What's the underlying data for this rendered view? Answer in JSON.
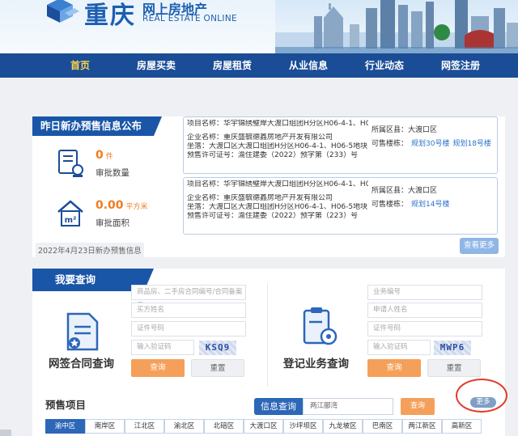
{
  "header": {
    "logo_cn": "重庆",
    "logo_sub": "网上房地产",
    "logo_en": "REAL ESTATE ONLINE"
  },
  "nav": [
    "首页",
    "房屋买卖",
    "房屋租赁",
    "从业信息",
    "行业动态",
    "网签注册"
  ],
  "yesterday": {
    "title": "昨日新办预售信息公布",
    "approval_count": "0",
    "approval_count_unit": "件",
    "approval_count_label": "审批数量",
    "approval_area": "0.00",
    "approval_area_unit": "平方米",
    "approval_area_label": "审批面积",
    "date_note": "2022年4月23日新办预售信息",
    "more": "查看更多",
    "items": [
      {
        "project": "项目名称：华宇锦绣璧岸大渡口组团H分区H06-4-1、H06-4-5、...",
        "company": "企业名称：重庆盛毓德鑫房地产开发有限公司",
        "location": "坐落：大渡口区大渡口组团H分区H06-4-1、H06-5地块",
        "license": "预售许可证号：渝住建委（2022）预字第（233）号",
        "district_label": "所属区县：大渡口区",
        "buildings_label": "可售楼栋：",
        "buildings": [
          "规划30号楼",
          "规划18号楼"
        ]
      },
      {
        "project": "项目名称：华宇锦绣璧岸大渡口组团H分区H06-4-1、H06-4-5、...",
        "company": "企业名称：重庆盛毓德鑫房地产开发有限公司",
        "location": "坐落：大渡口区大渡口组团H分区H06-4-1、H06-5地块",
        "license": "预售许可证号：渝住建委（2022）预字第（223）号",
        "district_label": "所属区县：大渡口区",
        "buildings_label": "可售楼栋：",
        "buildings": [
          "规划14号楼"
        ]
      }
    ]
  },
  "query": {
    "title": "我要查询",
    "contract": {
      "label": "网签合同查询",
      "field1": "商品房、二手房合同编号/合同备案号",
      "field2": "买方姓名",
      "field3": "证件号码",
      "captcha_placeholder": "输入验证码",
      "captcha": "KSQ9",
      "query_btn": "查询",
      "reset_btn": "重置"
    },
    "registration": {
      "label": "登记业务查询",
      "field1": "业务编号",
      "field2": "申请人姓名",
      "field3": "证件号码",
      "captcha_placeholder": "输入验证码",
      "captcha": "MWP6",
      "query_btn": "查询",
      "reset_btn": "重置"
    }
  },
  "presale_projects": {
    "title": "预售项目",
    "info_tab": "信息查询",
    "search_value": "两江郦湾",
    "search_btn": "查询",
    "more": "更多",
    "districts": [
      "渝中区",
      "南岸区",
      "江北区",
      "渝北区",
      "北碚区",
      "大渡口区",
      "沙坪坝区",
      "九龙坡区",
      "巴南区",
      "两江新区",
      "高新区"
    ]
  }
}
